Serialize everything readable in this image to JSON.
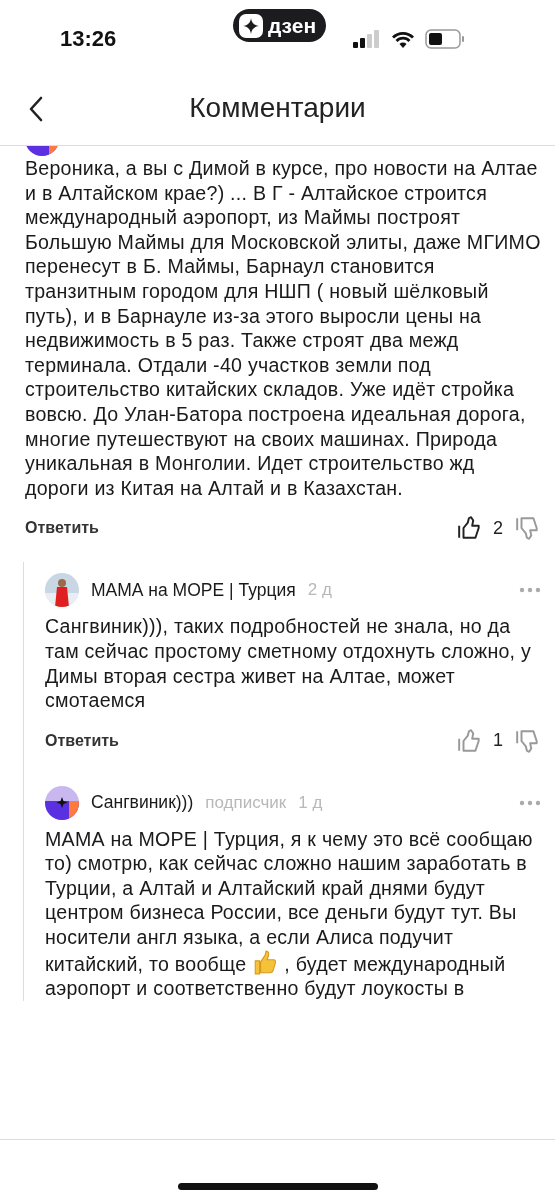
{
  "status_bar": {
    "time": "13:26",
    "app_badge": "дзен"
  },
  "header": {
    "title": "Комментарии"
  },
  "comments": [
    {
      "kind": "top",
      "text": "Вероника, а вы с Димой в курсе, про новости на Алтае и в Алтайском крае?) ... В Г - Алтайское строится международный аэропорт, из Маймы построят Большую Маймы для Московской элиты, даже МГИМО перенесут в Б. Маймы, Барнаул становится транзитным городом для НШП ( новый шёлковый путь), и в Барнауле из-за этого выросли цены на недвижимость в 5 раз. Также строят два межд терминала. Отдали -40 участков земли под строительство китайских складов. Уже идёт стройка вовсю. До Улан-Батора построена идеальная дорога, многие путешествуют на своих машинах. Природа уникальная в Монголии. Идет строительство жд дороги из Китая на Алтай и в Казахстан.",
      "reply": "Ответить",
      "likes": "2",
      "liked": true
    },
    {
      "kind": "reply",
      "author": "МАМА на МОРЕ | Турция",
      "time": "2 д",
      "text": "Сангвиник))), таких подробностей не знала, но да там сейчас простому сметному отдохнуть сложно, у Димы вторая сестра живет на Алтае, может смотаемся",
      "reply": "Ответить",
      "likes": "1",
      "liked": false
    },
    {
      "kind": "reply",
      "author": "Сангвиник)))",
      "badge": "подписчик",
      "time": "1 д",
      "text": "МАМА на МОРЕ | Турция, я к чему это всё сообщаю то) смотрю, как сейчас сложно нашим заработать в Турции, а Алтай и Алтайский край днями будут центром бизнеса России, все деньги будут тут. Вы носители англ языка, а если Алиса подучит китайский, то вообще",
      "text_after": ", будет международный аэропорт и соответственно будут лоукосты в"
    }
  ]
}
